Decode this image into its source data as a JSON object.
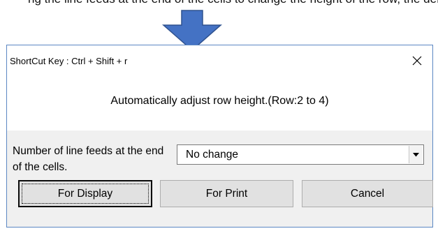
{
  "caption_partial": "ng the line feeds at the end of the cells to change the height of the row, the default setting is \"No change\".",
  "dialog": {
    "title": "ShortCut Key : Ctrl + Shift + r",
    "close_glyph": "✕",
    "message": "Automatically adjust row height.(Row:2 to 4)",
    "line_feed_label": "Number of line feeds at the end of the cells.",
    "line_feed_select": {
      "selected": "No change"
    },
    "buttons": {
      "display": "For Display",
      "print": "For Print",
      "cancel": "Cancel"
    },
    "focused_button": "display"
  },
  "icons": {
    "arrow": "down-arrow-icon",
    "close": "close-icon",
    "dropdown": "dropdown-arrow-icon"
  },
  "colors": {
    "arrow_fill": "#4472c4",
    "arrow_stroke": "#2f528f",
    "dialog_border": "#5b87c3",
    "dialog_body": "#f0f0f0",
    "button_face": "#e1e1e1"
  }
}
